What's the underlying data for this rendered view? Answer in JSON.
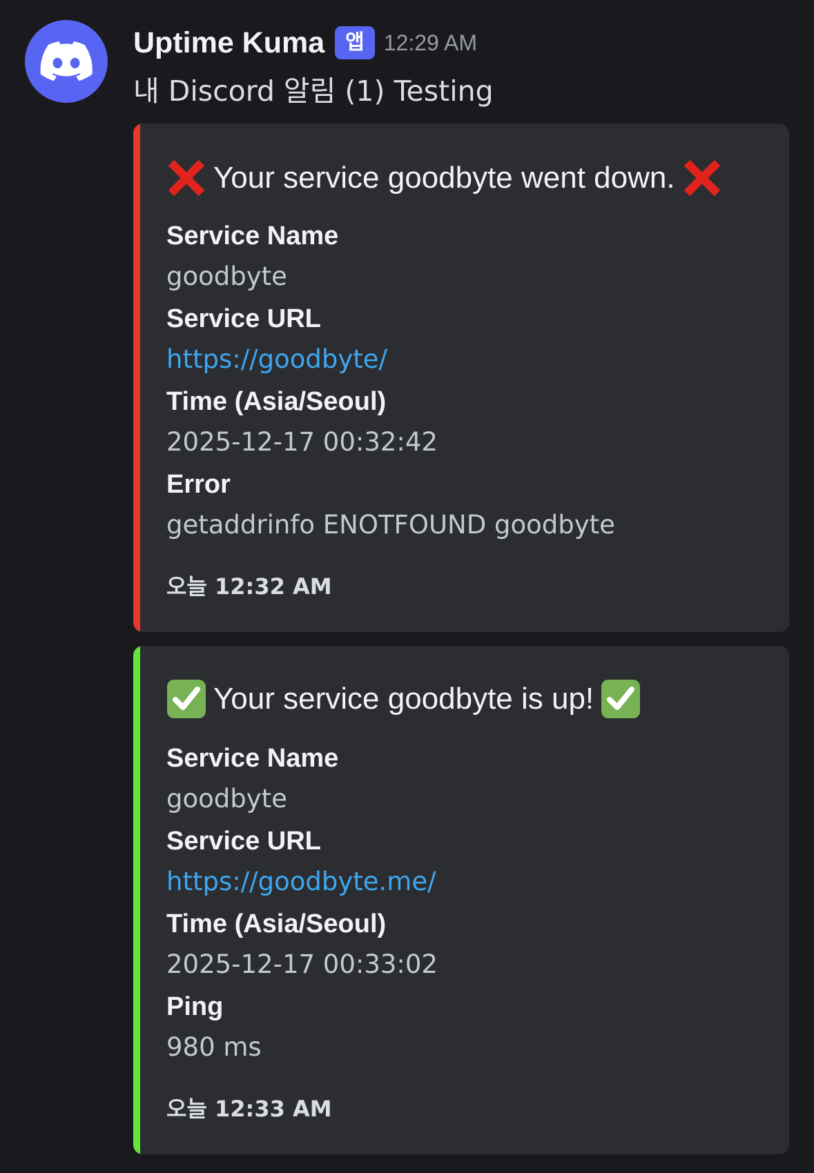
{
  "message": {
    "author": "Uptime Kuma",
    "app_badge": "앱",
    "timestamp": "12:29 AM",
    "content": "내 Discord 알림 (1) Testing"
  },
  "colors": {
    "down_bar": "#e5382f",
    "up_bar": "#61e63c",
    "link": "#3ea6ef",
    "brand": "#5865f2"
  },
  "embeds": [
    {
      "status": "down",
      "icon": "cross-mark-icon",
      "title": "Your service goodbyte went down.",
      "fields": [
        {
          "name": "Service Name",
          "value": "goodbyte"
        },
        {
          "name": "Service URL",
          "value": "https://goodbyte/"
        },
        {
          "name": "Time (Asia/Seoul)",
          "value": "2025-12-17 00:32:42"
        },
        {
          "name": "Error",
          "value": "getaddrinfo ENOTFOUND goodbyte"
        }
      ],
      "footer": "오늘 12:32 AM"
    },
    {
      "status": "up",
      "icon": "check-mark-button-icon",
      "title": "Your service goodbyte is up!",
      "fields": [
        {
          "name": "Service Name",
          "value": "goodbyte"
        },
        {
          "name": "Service URL",
          "value": "https://goodbyte.me/"
        },
        {
          "name": "Time (Asia/Seoul)",
          "value": "2025-12-17 00:33:02"
        },
        {
          "name": "Ping",
          "value": "980 ms"
        }
      ],
      "footer": "오늘 12:33 AM"
    }
  ]
}
